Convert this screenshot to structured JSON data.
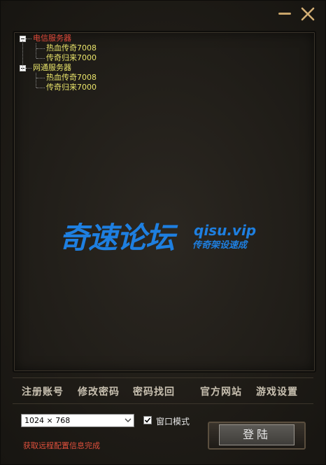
{
  "window": {
    "minimize_icon": "minimize-icon",
    "close_icon": "close-icon"
  },
  "server_tree": {
    "groups": [
      {
        "label": "电信服务器",
        "color": "#e24a3b",
        "children": [
          "热血传奇7008",
          "传奇归来7000"
        ]
      },
      {
        "label": "网通服务器",
        "color": "#e8e36a",
        "children": [
          "热血传奇7008",
          "传奇归来7000"
        ]
      }
    ]
  },
  "watermark": {
    "main": "奇速论坛",
    "url": "qisu.vip",
    "sub": "传奇架设速成",
    "color": "#1e7fe0"
  },
  "links": {
    "register": "注册账号",
    "change_password": "修改密码",
    "recover_password": "密码找回",
    "official_site": "官方网站",
    "game_settings": "游戏设置"
  },
  "settings": {
    "resolution_value": "1024 × 768",
    "window_mode_label": "窗口模式",
    "window_mode_checked": true
  },
  "status": {
    "message": "获取远程配置信息完成",
    "color": "#e0503c"
  },
  "login": {
    "label": "登陆"
  }
}
